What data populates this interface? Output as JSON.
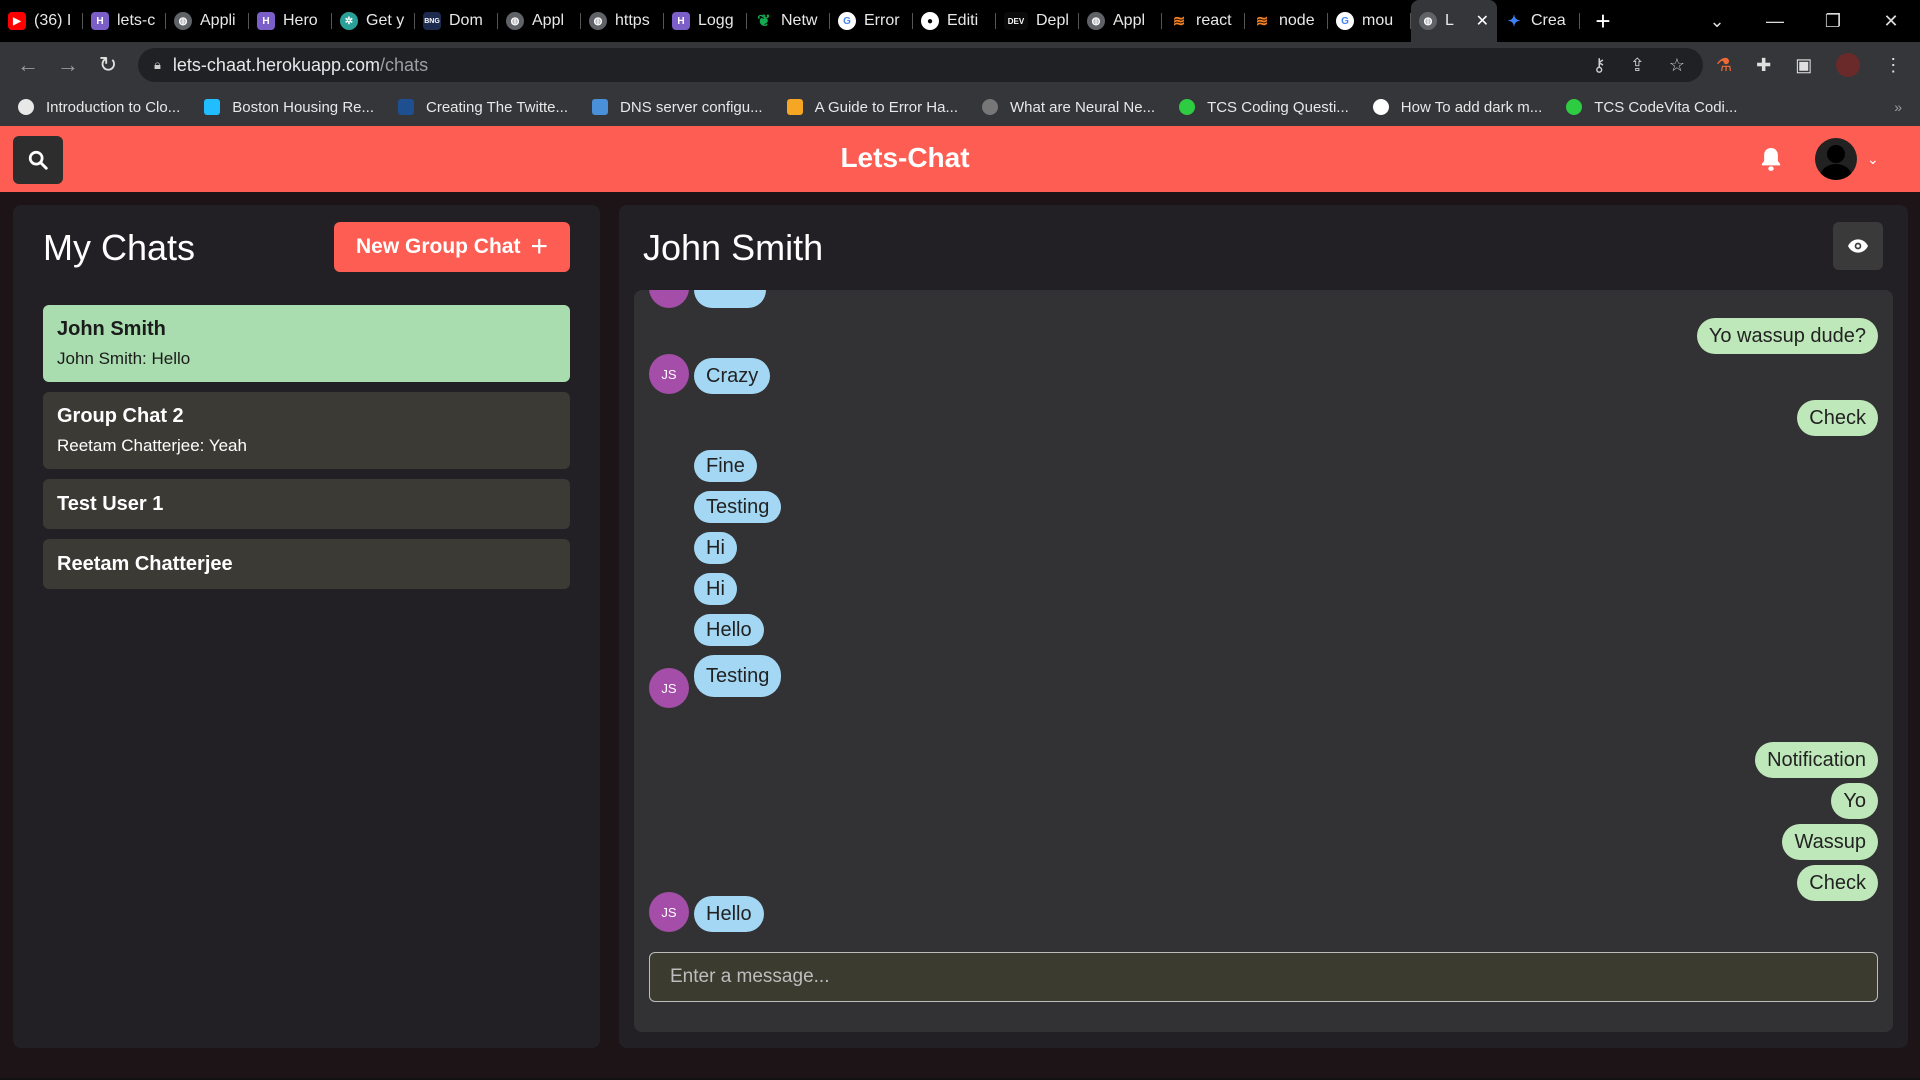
{
  "browser": {
    "tabs": [
      {
        "label": "(36) I",
        "favicon_color": "#ff0000",
        "favicon": "youtube-icon"
      },
      {
        "label": "lets-c",
        "favicon_color": "#7c5ec9",
        "favicon": "heroku-icon"
      },
      {
        "label": "Appli",
        "favicon_color": "#5f6368",
        "favicon": "globe-icon"
      },
      {
        "label": "Hero",
        "favicon_color": "#7c5ec9",
        "favicon": "heroku-icon"
      },
      {
        "label": "Get y",
        "favicon_color": "#2aa198",
        "favicon": "openai-icon"
      },
      {
        "label": "Dom",
        "favicon_color": "#1d2b4f",
        "favicon": "bng-icon"
      },
      {
        "label": "Appl",
        "favicon_color": "#5f6368",
        "favicon": "globe-icon"
      },
      {
        "label": "https",
        "favicon_color": "#5f6368",
        "favicon": "globe-icon"
      },
      {
        "label": "Logg",
        "favicon_color": "#7c5ec9",
        "favicon": "heroku-icon"
      },
      {
        "label": "Netw",
        "favicon_color": "#13aa52",
        "favicon": "mongodb-icon"
      },
      {
        "label": "Error",
        "favicon_color": "#ffffff",
        "favicon": "google-icon"
      },
      {
        "label": "Editi",
        "favicon_color": "#ffffff",
        "favicon": "github-icon"
      },
      {
        "label": "Depl",
        "favicon_color": "#0a0a0a",
        "favicon": "dev-icon"
      },
      {
        "label": "Appl",
        "favicon_color": "#5f6368",
        "favicon": "globe-icon"
      },
      {
        "label": "react",
        "favicon_color": "#f48024",
        "favicon": "stackoverflow-icon"
      },
      {
        "label": "node",
        "favicon_color": "#f48024",
        "favicon": "stackoverflow-icon"
      },
      {
        "label": "mou",
        "favicon_color": "#ffffff",
        "favicon": "google-icon"
      },
      {
        "label": "L",
        "favicon_color": "#5f6368",
        "favicon": "globe-icon",
        "active": true
      },
      {
        "label": "Crea",
        "favicon_color": "#3b82f6",
        "favicon": "star-icon"
      }
    ],
    "dev_badge": "DEV",
    "bng_badge": "BNG",
    "url_host": "lets-chaat.herokuapp.com",
    "url_path": "/chats",
    "bookmarks": [
      {
        "label": "Introduction to Clo...",
        "icon_color": "#e8e8e8"
      },
      {
        "label": "Boston Housing Re...",
        "icon_color": "#20beff"
      },
      {
        "label": "Creating The Twitte...",
        "icon_color": "#1d4f91"
      },
      {
        "label": "DNS server configu...",
        "icon_color": "#4a90d9"
      },
      {
        "label": "A Guide to Error Ha...",
        "icon_color": "#f5a623"
      },
      {
        "label": "What are Neural Ne...",
        "icon_color": "#777777"
      },
      {
        "label": "TCS Coding Questi...",
        "icon_color": "#2ecc40"
      },
      {
        "label": "How To add dark m...",
        "icon_color": "#ffffff"
      },
      {
        "label": "TCS CodeVita Codi...",
        "icon_color": "#2ecc40"
      }
    ]
  },
  "app": {
    "title": "Lets-Chat",
    "brand_color": "#fd5d52"
  },
  "chats": {
    "title": "My Chats",
    "new_group_label": "New Group Chat",
    "items": [
      {
        "name": "John Smith",
        "last": "John Smith: Hello",
        "selected": true
      },
      {
        "name": "Group Chat 2",
        "last": "Reetam Chatterjee: Yeah",
        "selected": false
      },
      {
        "name": "Test User 1",
        "last": "",
        "selected": false
      },
      {
        "name": "Reetam Chatterjee",
        "last": "",
        "selected": false
      }
    ]
  },
  "conversation": {
    "title": "John Smith",
    "avatar_initials": "JS",
    "messages": [
      {
        "from": "them",
        "text": "Yo wassup dude?"
      },
      {
        "from": "them",
        "text": "Crazy"
      },
      {
        "from": "me",
        "text": "Check"
      },
      {
        "from": "them",
        "text": "Fine"
      },
      {
        "from": "them",
        "text": "Testing"
      },
      {
        "from": "them",
        "text": "Hi"
      },
      {
        "from": "them",
        "text": "Hi"
      },
      {
        "from": "them",
        "text": "Hello"
      },
      {
        "from": "them",
        "text": "Testing"
      },
      {
        "from": "me",
        "text": "Notification"
      },
      {
        "from": "me",
        "text": "Yo"
      },
      {
        "from": "me",
        "text": "Wassup"
      },
      {
        "from": "me",
        "text": "Check"
      },
      {
        "from": "them",
        "text": "Hello"
      }
    ],
    "input_placeholder": "Enter a message...",
    "incoming_color": "#a3d7f3",
    "outgoing_color": "#bfe8ba"
  }
}
